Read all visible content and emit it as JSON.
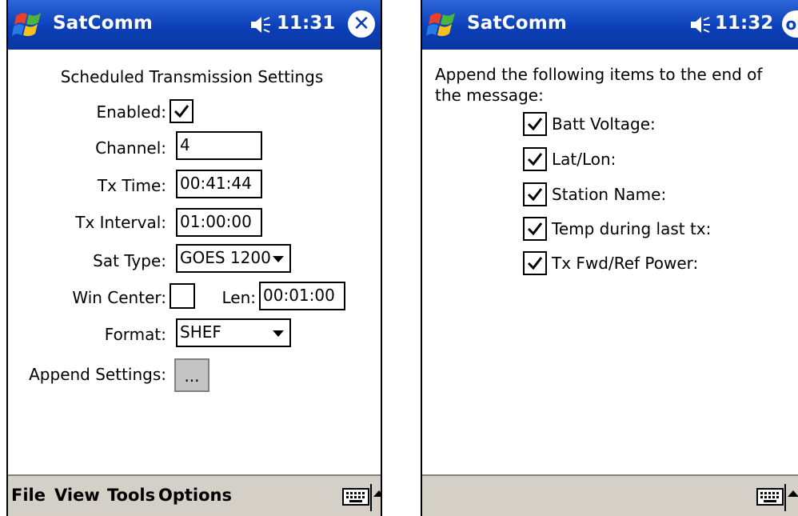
{
  "left": {
    "titlebar": {
      "app_name": "SatComm",
      "time": "11:31",
      "close_symbol": "✕"
    },
    "heading": "Scheduled Transmission Settings",
    "fields": {
      "enabled_label": "Enabled:",
      "enabled_checked": true,
      "channel_label": "Channel:",
      "channel_value": "4",
      "tx_time_label": "Tx Time:",
      "tx_time_value": "00:41:44",
      "tx_interval_label": "Tx Interval:",
      "tx_interval_value": "01:00:00",
      "sat_type_label": "Sat Type:",
      "sat_type_value": "GOES 1200",
      "win_center_label": "Win Center:",
      "win_center_checked": false,
      "len_label": "Len:",
      "len_value": "00:01:00",
      "format_label": "Format:",
      "format_value": "SHEF",
      "append_label": "Append Settings:",
      "append_button_label": "..."
    },
    "menubar": {
      "items": [
        "File",
        "View",
        "Tools",
        "Options"
      ]
    }
  },
  "right": {
    "titlebar": {
      "app_name": "SatComm",
      "time": "11:32",
      "ok_label": "ok"
    },
    "intro": "Append the following items to the end of the message:",
    "items": [
      {
        "label": "Batt Voltage:",
        "checked": true
      },
      {
        "label": "Lat/Lon:",
        "checked": true
      },
      {
        "label": "Station Name:",
        "checked": true
      },
      {
        "label": "Temp during last tx:",
        "checked": true
      },
      {
        "label": "Tx Fwd/Ref Power:",
        "checked": true
      }
    ]
  },
  "colors": {
    "titlebar": "#0b3fb8",
    "menubar": "#d4d0c8",
    "button_gray": "#c4c4c4"
  },
  "icons": [
    "windows-start-icon",
    "speaker-icon",
    "close-icon",
    "ok-icon",
    "keyboard-icon",
    "up-arrow-icon",
    "checkmark-icon",
    "dropdown-arrow-icon"
  ]
}
